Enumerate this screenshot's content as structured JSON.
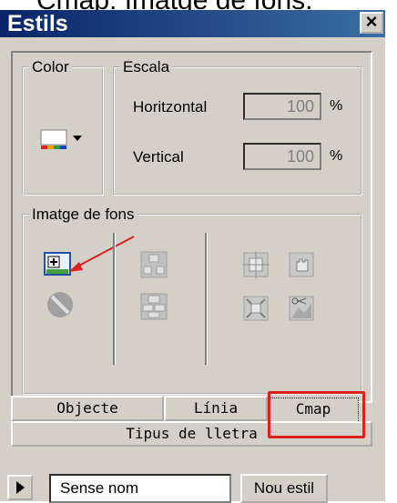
{
  "caption": "Cmap: Imatge de fons.",
  "window": {
    "title": "Estils",
    "close_label": "×"
  },
  "color_group": {
    "legend": "Color"
  },
  "scale_group": {
    "legend": "Escala",
    "horizontal_label": "Horitzontal",
    "horizontal_value": "100",
    "vertical_label": "Vertical",
    "vertical_value": "100",
    "unit": "%"
  },
  "background_group": {
    "legend": "Imatge de fons"
  },
  "tabs": {
    "objecte": "Objecte",
    "linia": "Línia",
    "cmap": "Cmap",
    "tipus": "Tipus de lletra"
  },
  "footer": {
    "style_name": "Sense nom",
    "new_style": "Nou estil"
  },
  "colors": {
    "title_bar": "#0a246a",
    "window_bg": "#d4d0c8",
    "highlight": "#e02020"
  }
}
